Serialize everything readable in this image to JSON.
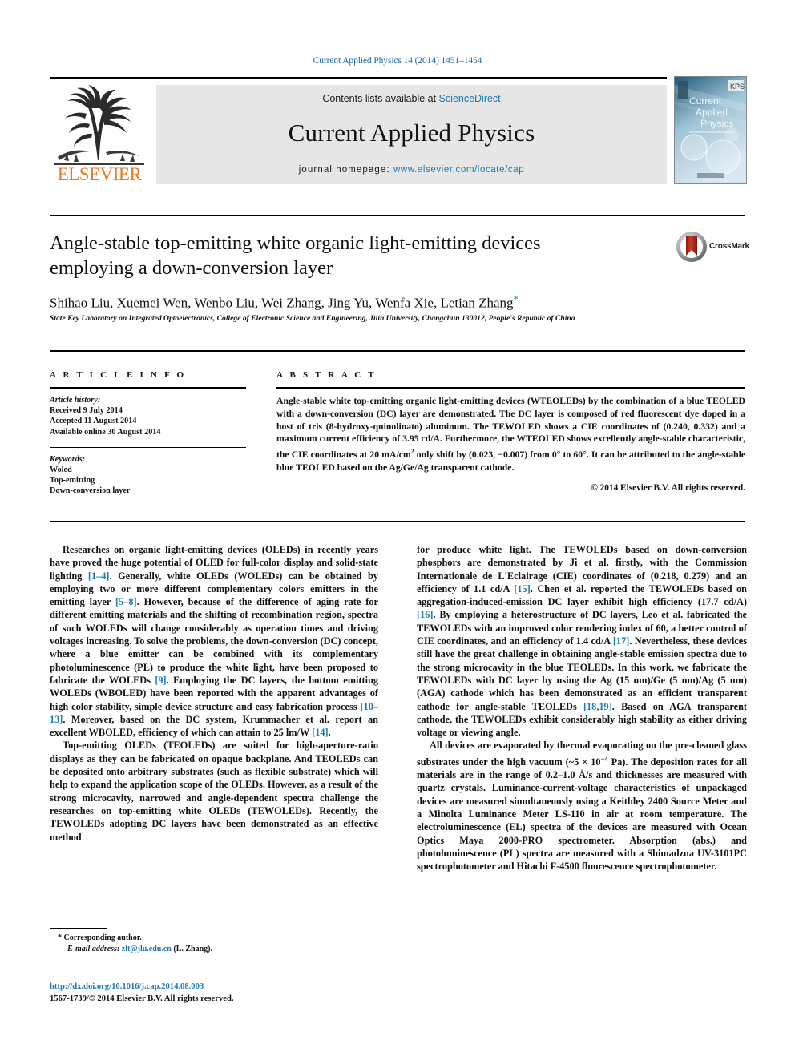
{
  "running_head": "Current Applied Physics 14 (2014) 1451–1454",
  "masthead": {
    "contents_prefix": "Contents lists available at ",
    "contents_link": "ScienceDirect",
    "journal_title": "Current Applied Physics",
    "homepage_prefix": "journal homepage: ",
    "homepage_url": "www.elsevier.com/locate/cap",
    "publisher": "ELSEVIER",
    "cover_lines": [
      "Current",
      "Applied",
      "Physics"
    ],
    "cover_badge": "KPS"
  },
  "article": {
    "title": "Angle-stable top-emitting white organic light-emitting devices employing a down-conversion layer",
    "authors": "Shihao Liu, Xuemei Wen, Wenbo Liu, Wei Zhang, Jing Yu, Wenfa Xie, Letian Zhang",
    "corresponding_marker": "*",
    "affiliation": "State Key Laboratory on Integrated Optoelectronics, College of Electronic Science and Engineering, Jilin University, Changchun 130012, People's Republic of China",
    "crossmark_label": "CrossMark"
  },
  "info": {
    "heading": "A R T I C L E   I N F O",
    "history_label": "Article history:",
    "history": [
      "Received 9 July 2014",
      "Accepted 11 August 2014",
      "Available online 30 August 2014"
    ],
    "keywords_label": "Keywords:",
    "keywords": [
      "Woled",
      "Top-emitting",
      "Down-conversion layer"
    ]
  },
  "abstract": {
    "heading": "A B S T R A C T",
    "text_part1": "Angle-stable white top-emitting organic light-emitting devices (WTEOLEDs) by the combination of a blue TEOLED with a down-conversion (DC) layer are demonstrated. The DC layer is composed of red fluorescent dye doped in a host of tris (8-hydroxy-quinolinato) aluminum. The TEWOLED shows a CIE coordinates of (0.240, 0.332) and a maximum current efficiency of 3.95 cd/A. Furthermore, the WTEOLED shows excellently angle-stable characteristic, the CIE coordinates at 20 mA/cm",
    "text_sup": "2",
    "text_part2": " only shift by (0.023, −0.007) from 0° to 60°. It can be attributed to the angle-stable blue TEOLED based on the Ag/Ge/Ag transparent cathode.",
    "copyright": "© 2014 Elsevier B.V. All rights reserved."
  },
  "body": {
    "left": {
      "p1_a": "Researches on organic light-emitting devices (OLEDs) in recently years have proved the huge potential of OLED for full-color display and solid-state lighting ",
      "p1_r1": "[1–4]",
      "p1_b": ". Generally, white OLEDs (WOLEDs) can be obtained by employing two or more different complementary colors emitters in the emitting layer ",
      "p1_r2": "[5–8]",
      "p1_c": ". However, because of the difference of aging rate for different emitting materials and the shifting of recombination region, spectra of such WOLEDs will change considerably as operation times and driving voltages increasing. To solve the problems, the down-conversion (DC) concept, where a blue emitter can be combined with its complementary photoluminescence (PL) to produce the white light, have been proposed to fabricate the WOLEDs ",
      "p1_r3": "[9]",
      "p1_d": ". Employing the DC layers, the bottom emitting WOLEDs (WBOLED) have been reported with the apparent advantages of high color stability, simple device structure and easy fabrication process ",
      "p1_r4": "[10–13]",
      "p1_e": ". Moreover, based on the DC system, Krummacher et al. report an excellent WBOLED, efficiency of which can attain to 25 lm/W ",
      "p1_r5": "[14]",
      "p1_f": ".",
      "p2": "Top-emitting OLEDs (TEOLEDs) are suited for high-aperture-ratio displays as they can be fabricated on opaque backplane. And TEOLEDs can be deposited onto arbitrary substrates (such as flexible substrate) which will help to expand the application scope of the OLEDs. However, as a result of the strong microcavity, narrowed and angle-dependent spectra challenge the researches on top-emitting white OLEDs (TEWOLEDs). Recently, the TEWOLEDs adopting DC layers have been demonstrated as an effective method"
    },
    "right": {
      "p1_a": "for produce white light. The TEWOLEDs based on down-conversion phosphors are demonstrated by Ji et al. firstly, with the Commission Internationale de L'Eclairage (CIE) coordinates of (0.218, 0.279) and an efficiency of 1.1 cd/A ",
      "p1_r1": "[15]",
      "p1_b": ". Chen et al. reported the TEWOLEDs based on aggregation-induced-emission DC layer exhibit high efficiency (17.7 cd/A) ",
      "p1_r2": "[16]",
      "p1_c": ". By employing a heterostructure of DC layers, Leo et al. fabricated the TEWOLEDs with an improved color rendering index of 60, a better control of CIE coordinates, and an efficiency of 1.4 cd/A ",
      "p1_r3": "[17]",
      "p1_d": ". Nevertheless, these devices still have the great challenge in obtaining angle-stable emission spectra due to the strong microcavity in the blue TEOLEDs. In this work, we fabricate the TEWOLEDs with DC layer by using the Ag (15 nm)/Ge (5 nm)/Ag (5 nm) (AGA) cathode which has been demonstrated as an efficient transparent cathode for angle-stable TEOLEDs ",
      "p1_r4": "[18,19]",
      "p1_e": ". Based on AGA transparent cathode, the TEWOLEDs exhibit considerably high stability as either driving voltage or viewing angle.",
      "p2_a": "All devices are evaporated by thermal evaporating on the pre-cleaned glass substrates under the high vacuum (~5 × 10",
      "p2_sup": "−4",
      "p2_b": " Pa). The deposition rates for all materials are in the range of 0.2–1.0 Å/s and thicknesses are measured with quartz crystals. Luminance-current-voltage characteristics of unpackaged devices are measured simultaneously using a Keithley 2400 Source Meter and a Minolta Luminance Meter LS-110 in air at room temperature. The electroluminescence (EL) spectra of the devices are measured with Ocean Optics Maya 2000-PRO spectrometer. Absorption (abs.) and photoluminescence (PL) spectra are measured with a Shimadzua UV-3101PC spectrophotometer and Hitachi F-4500 fluorescence spectrophotometer."
    }
  },
  "footnote": {
    "marker": "*",
    "corresponding": "Corresponding author.",
    "email_label": "E-mail address:",
    "email": "zlt@jlu.edu.cn",
    "email_owner": "(L. Zhang)."
  },
  "footer": {
    "doi": "http://dx.doi.org/10.1016/j.cap.2014.08.003",
    "issn_line": "1567-1739/© 2014 Elsevier B.V. All rights reserved."
  },
  "colors": {
    "link": "#1a7ab5",
    "elsevier_orange": "#E87722",
    "rule": "#000000"
  }
}
